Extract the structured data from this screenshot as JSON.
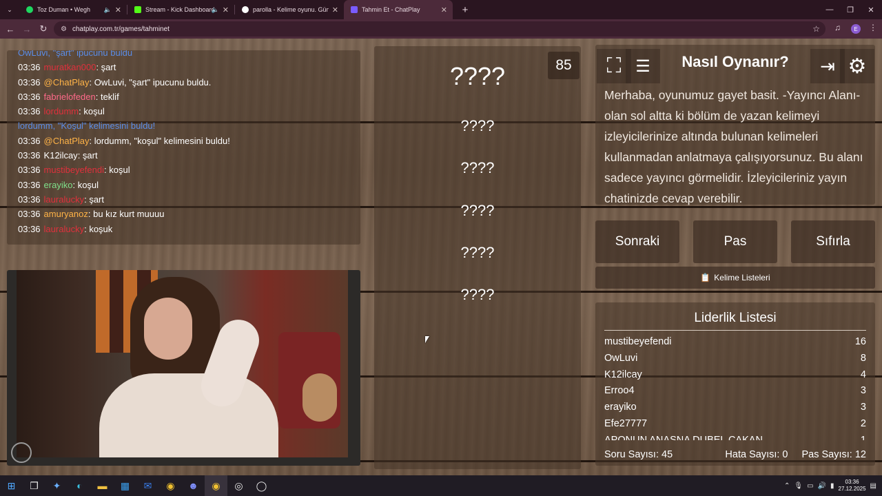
{
  "browser": {
    "tabs": [
      {
        "title": "Toz Duman • Wegh",
        "color": "#1ed760"
      },
      {
        "title": "Stream - Kick Dashboard",
        "color": "#53fc18"
      },
      {
        "title": "parolla - Kelime oyunu. Günlük",
        "color": "#ffffff"
      },
      {
        "title": "Tahmin Et - ChatPlay",
        "color": "#7a5cff"
      }
    ],
    "url": "chatplay.com.tr/games/tahminet",
    "profile": "E"
  },
  "chat": {
    "lines": [
      {
        "time": "",
        "user": "OwLuvi, ",
        "sep": "",
        "text": "\"şart\" ipucunu buldu",
        "ucolor": "#5b8de8",
        "tcolor": "#5b8de8"
      },
      {
        "time": "03:36",
        "user": "muratkan000",
        "sep": ": ",
        "text": "şart",
        "ucolor": "#e0303c"
      },
      {
        "time": "03:36",
        "user": "@ChatPlay",
        "sep": ": ",
        "text": "OwLuvi, \"şart\" ipucunu buldu.",
        "ucolor": "#ffb347"
      },
      {
        "time": "03:36",
        "user": "fabrielofeden",
        "sep": ": ",
        "text": "teklif",
        "ucolor": "#ff6a8a"
      },
      {
        "time": "03:36",
        "user": "lordumm",
        "sep": ": ",
        "text": "koşul",
        "ucolor": "#e0303c"
      },
      {
        "time": "",
        "user": "lordumm, ",
        "sep": "",
        "text": "\"Koşul\" kelimesini buldu!",
        "ucolor": "#5b8de8",
        "tcolor": "#5b8de8"
      },
      {
        "time": "03:36",
        "user": "@ChatPlay",
        "sep": ": ",
        "text": "lordumm, \"koşul\" kelimesini buldu!",
        "ucolor": "#ffb347"
      },
      {
        "time": "03:36",
        "user": "K12ilcay",
        "sep": ": ",
        "text": "şart",
        "ucolor": "#ffffff"
      },
      {
        "time": "03:36",
        "user": "mustibeyefendi",
        "sep": ": ",
        "text": "koşul",
        "ucolor": "#e0303c"
      },
      {
        "time": "03:36",
        "user": "erayiko",
        "sep": ": ",
        "text": "koşul",
        "ucolor": "#7fe08a"
      },
      {
        "time": "03:36",
        "user": "lauralucky",
        "sep": ": ",
        "text": "şart",
        "ucolor": "#e0303c"
      },
      {
        "time": "03:36",
        "user": "amuryanoz",
        "sep": ": ",
        "text": "bu kız kurt muuuu",
        "ucolor": "#ffb347"
      },
      {
        "time": "03:36",
        "user": "lauralucky",
        "sep": ": ",
        "text": "koşuk",
        "ucolor": "#e0303c"
      }
    ]
  },
  "game": {
    "counter": "85",
    "main_word": "????",
    "taboo": [
      "????",
      "????",
      "????",
      "????",
      "????"
    ]
  },
  "howto": {
    "title": "Nasıl Oynanır?",
    "text": "Merhaba, oyunumuz gayet basit. -Yayıncı Alanı- olan sol altta ki bölüm de yazan kelimeyi izleyicilerinize altında bulunan kelimeleri kullanmadan anlatmaya çalışıyorsunuz. Bu alanı sadece yayıncı görmelidir. İzleyicileriniz yayın chatinizde cevap verebilir."
  },
  "buttons": {
    "next": "Sonraki",
    "pass": "Pas",
    "reset": "Sıfırla",
    "lists": "Kelime Listeleri"
  },
  "leaderboard": {
    "title": "Liderlik Listesi",
    "rows": [
      {
        "name": "mustibeyefendi",
        "score": "16"
      },
      {
        "name": "OwLuvi",
        "score": "8"
      },
      {
        "name": "K12ilcay",
        "score": "4"
      },
      {
        "name": "Erroo4",
        "score": "3"
      },
      {
        "name": "erayiko",
        "score": "3"
      },
      {
        "name": "Efe27777",
        "score": "2"
      },
      {
        "name": "APONUN ANASNA DUBEL ÇAKAN",
        "score": "1"
      }
    ]
  },
  "stats": {
    "questions": "Soru Sayısı: 45",
    "errors": "Hata Sayısı: 0",
    "passes": "Pas Sayısı: 12"
  },
  "taskbar": {
    "time": "03:36",
    "date": "27.12.2025"
  }
}
